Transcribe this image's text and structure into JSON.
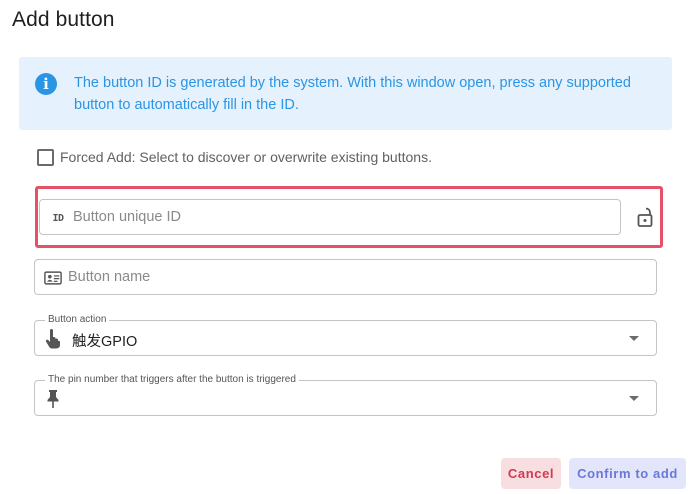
{
  "dialog": {
    "title": "Add button"
  },
  "info": {
    "icon": "info-icon",
    "glyph": "i",
    "text": "The button ID is generated by the system. With this window open, press any supported button to automatically fill in the ID."
  },
  "forced_add": {
    "checked": false,
    "label": "Forced Add: Select to discover or overwrite existing buttons."
  },
  "fields": {
    "button_id": {
      "icon": "id-icon",
      "glyph": "ID",
      "placeholder": "Button unique ID",
      "value": ""
    },
    "button_name": {
      "icon": "id-card-icon",
      "placeholder": "Button name",
      "value": ""
    },
    "button_action": {
      "label": "Button action",
      "icon": "pointing-hand-icon",
      "value": "触发GPIO"
    },
    "pin_number": {
      "label": "The pin number that triggers after the button is triggered",
      "icon": "pin-icon",
      "value": ""
    }
  },
  "lock": {
    "icon": "unlock-icon"
  },
  "actions": {
    "cancel_label": "Cancel",
    "confirm_label": "Confirm to add"
  },
  "colors": {
    "info_background": "#e5f1fc",
    "info_text": "#2b95e5",
    "highlight_border": "#e45169",
    "cancel_background": "#f8dde1",
    "cancel_text": "#d23a52",
    "confirm_background": "#e3e6fb",
    "confirm_text": "#6a78d8"
  }
}
